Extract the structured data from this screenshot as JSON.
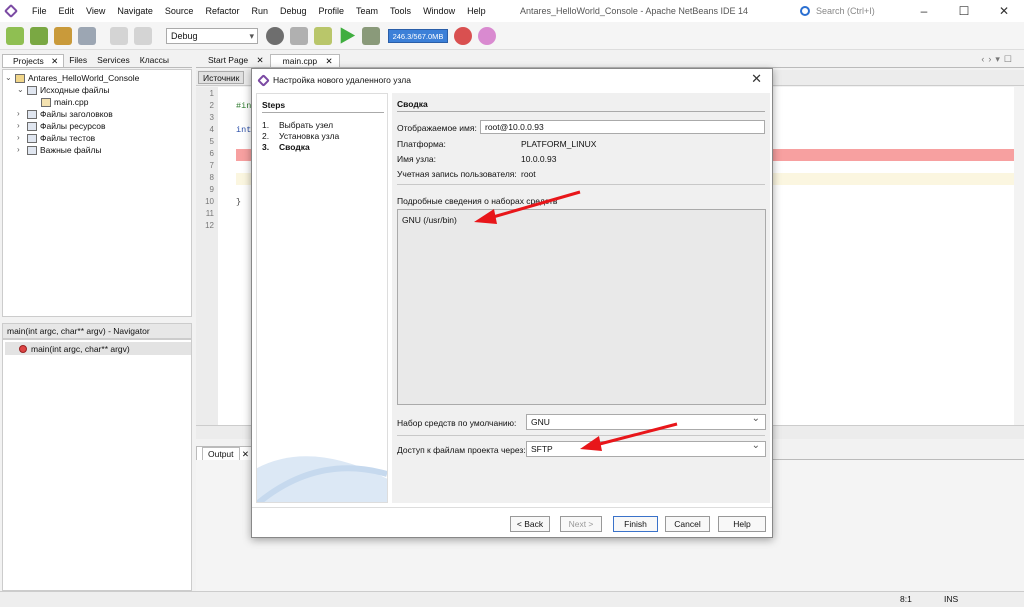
{
  "window": {
    "title": "Antares_HelloWorld_Console - Apache NetBeans IDE 14",
    "search_placeholder": "Search (Ctrl+I)"
  },
  "menu": [
    "File",
    "Edit",
    "View",
    "Navigate",
    "Source",
    "Refactor",
    "Run",
    "Debug",
    "Profile",
    "Team",
    "Tools",
    "Window",
    "Help"
  ],
  "toolbar": {
    "configuration": "Debug",
    "memory": "246.3/567.0MB"
  },
  "left_panel": {
    "tabs": [
      "Projects",
      "Files",
      "Services",
      "Классы"
    ],
    "tree": {
      "project": "Antares_HelloWorld_Console",
      "source_files": "Исходные файлы",
      "main_file": "main.cpp",
      "header_files": "Файлы заголовков",
      "resource_files": "Файлы ресурсов",
      "test_files": "Файлы тестов",
      "important_files": "Важные файлы"
    }
  },
  "navigator": {
    "title": "main(int argc, char** argv) - Navigator",
    "item": "main(int argc, char** argv)"
  },
  "editor": {
    "tabs": [
      "Start Page",
      "main.cpp"
    ],
    "source_button": "Источник",
    "line_numbers": [
      "1",
      "2",
      "3",
      "4",
      "5",
      "6",
      "7",
      "8",
      "9",
      "10",
      "11",
      "12"
    ],
    "code_include": "#in",
    "code_int": "int",
    "code_brace": "}"
  },
  "output": {
    "tab": "Output"
  },
  "status": {
    "position": "8:1",
    "mode": "INS"
  },
  "dialog": {
    "title": "Настройка нового удаленного узла",
    "steps_header": "Steps",
    "steps": [
      {
        "n": "1.",
        "label": "Выбрать узел"
      },
      {
        "n": "2.",
        "label": "Установка узла"
      },
      {
        "n": "3.",
        "label": "Сводка"
      }
    ],
    "summary_header": "Сводка",
    "display_name_label": "Отображаемое имя:",
    "display_name_value": "root@10.0.0.93",
    "platform_label": "Платформа:",
    "platform_value": "PLATFORM_LINUX",
    "host_label": "Имя узла:",
    "host_value": "10.0.0.93",
    "user_label": "Учетная запись пользователя:",
    "user_value": "root",
    "toolsets_label": "Подробные сведения о наборах средств",
    "toolsets_detail": "GNU (/usr/bin)",
    "default_toolset_label": "Набор средств по умолчанию:",
    "default_toolset_value": "GNU",
    "access_label": "Доступ к файлам проекта через:",
    "access_value": "SFTP",
    "buttons": {
      "back": "< Back",
      "next": "Next >",
      "finish": "Finish",
      "cancel": "Cancel",
      "help": "Help"
    }
  },
  "colors": {
    "accent": "#2f65ca",
    "annotation_arrow": "#e8161a",
    "error_line": "#f7a0a0"
  }
}
